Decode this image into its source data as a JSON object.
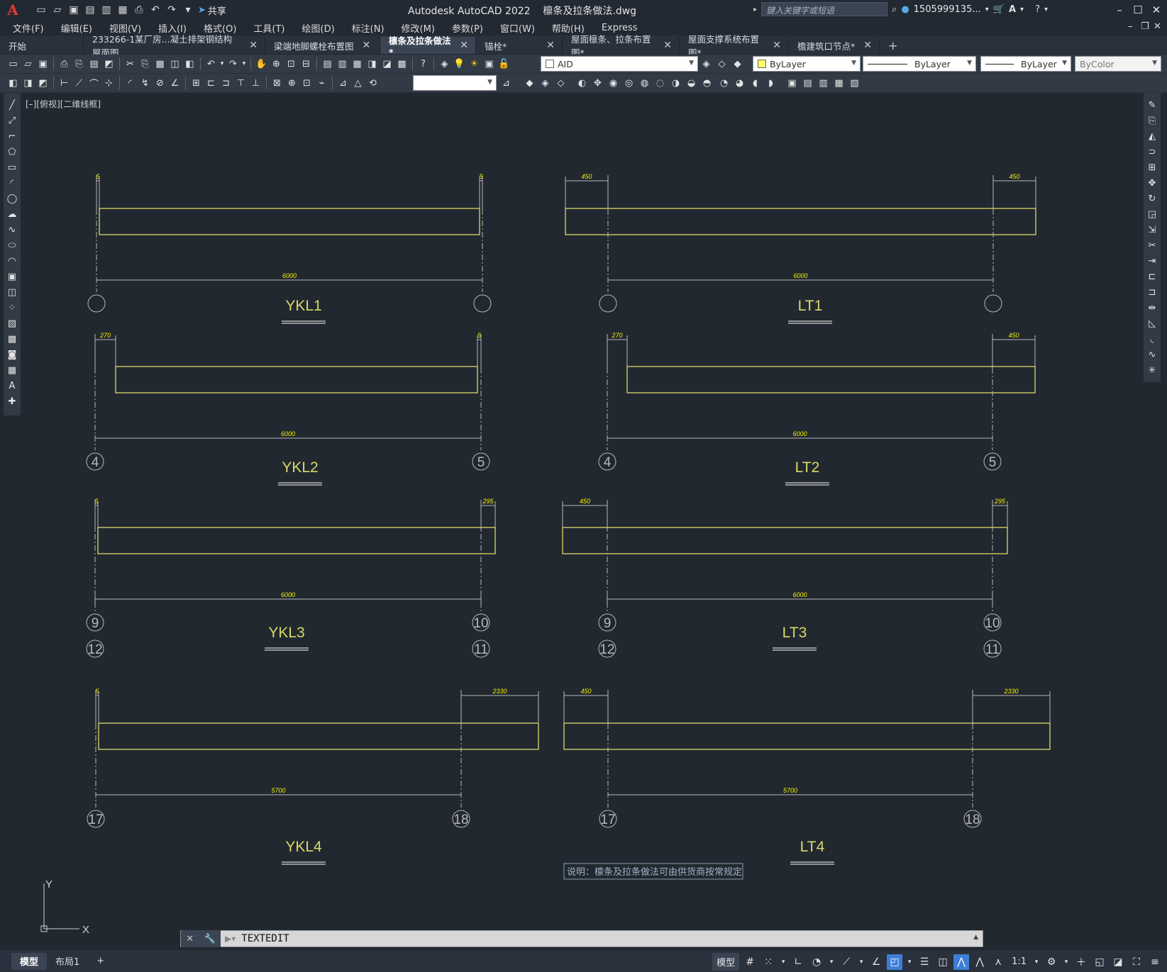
{
  "app": {
    "logo": "A",
    "title": "Autodesk AutoCAD 2022    檩条及拉条做法.dwg",
    "share_label": "共享",
    "search_placeholder": "键入关键字或短语",
    "user": "1505999135...",
    "window_buttons": [
      "–",
      "☐",
      "✕"
    ]
  },
  "menu": [
    "文件(F)",
    "编辑(E)",
    "视图(V)",
    "插入(I)",
    "格式(O)",
    "工具(T)",
    "绘图(D)",
    "标注(N)",
    "修改(M)",
    "参数(P)",
    "窗口(W)",
    "帮助(H)",
    "Express"
  ],
  "tabs": [
    {
      "label": "开始",
      "active": false,
      "closable": false
    },
    {
      "label": "233266-1某厂房...凝土排架钢结构屋面图",
      "active": false,
      "closable": true
    },
    {
      "label": "梁端地脚螺栓布置图",
      "active": false,
      "closable": true
    },
    {
      "label": "檩条及拉条做法*",
      "active": true,
      "closable": true
    },
    {
      "label": "锚栓*",
      "active": false,
      "closable": true
    },
    {
      "label": "屋面檩条、拉条布置图*",
      "active": false,
      "closable": true
    },
    {
      "label": "屋面支撑系统布置图*",
      "active": false,
      "closable": true
    },
    {
      "label": "檐建筑口节点*",
      "active": false,
      "closable": true
    }
  ],
  "properties": {
    "layer": "AID",
    "color": "ByLayer",
    "linetype": "ByLayer",
    "lineweight": "ByLayer",
    "plotstyle": "ByColor",
    "color_swatch": "#ffff66"
  },
  "viewport_label": "[–][俯视][二维线框]",
  "drawing": {
    "line_color": "#d9d968",
    "dim_color": "#f2f200",
    "grid_color": "#b8b8b8",
    "beams": [
      {
        "name": "YKL1",
        "left_dim": "5",
        "right_dim": "5",
        "span": "6000",
        "axes": [
          "",
          ""
        ],
        "axes2": null
      },
      {
        "name": "LT1",
        "left_dim": "450",
        "right_dim": "450",
        "span": "6000",
        "axes": [
          "",
          ""
        ],
        "axes2": null
      },
      {
        "name": "YKL2",
        "left_dim": "270",
        "right_dim": "5",
        "span": "6000",
        "axes": [
          "4",
          "5"
        ],
        "axes2": null
      },
      {
        "name": "LT2",
        "left_dim": "270",
        "right_dim": "450",
        "span": "6000",
        "axes": [
          "4",
          "5"
        ],
        "axes2": null
      },
      {
        "name": "YKL3",
        "left_dim": "5",
        "right_dim": "295",
        "span": "6000",
        "axes": [
          "9",
          "10"
        ],
        "axes2": [
          "12",
          "11"
        ]
      },
      {
        "name": "LT3",
        "left_dim": "450",
        "right_dim": "295",
        "span": "6000",
        "axes": [
          "9",
          "10"
        ],
        "axes2": [
          "12",
          "11"
        ]
      },
      {
        "name": "YKL4",
        "left_dim": "5",
        "right_dim": "2330",
        "span": "5700",
        "axes": [
          "17",
          "18"
        ],
        "axes2": null
      },
      {
        "name": "LT4",
        "left_dim": "450",
        "right_dim": "2330",
        "span": "5700",
        "axes": [
          "17",
          "18"
        ],
        "axes2": null
      }
    ],
    "note": "说明：檩条及拉条做法可由供货商按常规定"
  },
  "ucs": {
    "y": "Y",
    "x": "X"
  },
  "command": {
    "text": "TEXTEDIT"
  },
  "layouts": [
    "模型",
    "布局1",
    "+"
  ],
  "status": {
    "model": "模型",
    "scale": "1:1"
  }
}
